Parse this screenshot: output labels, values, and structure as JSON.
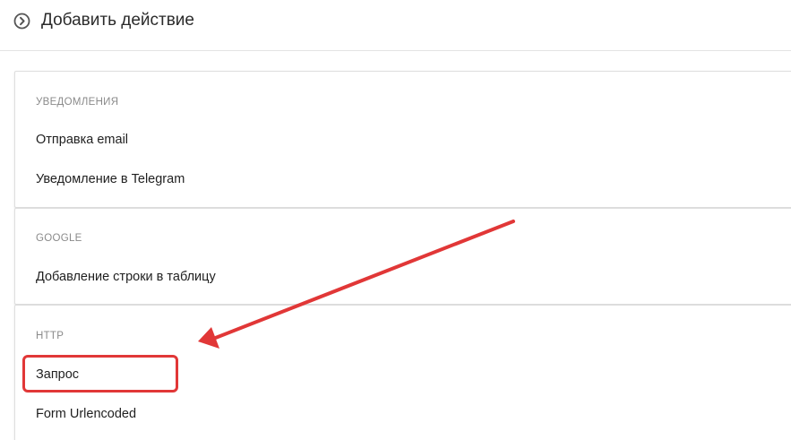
{
  "header": {
    "title": "Добавить действие",
    "icon": "chevron-circle-right-icon"
  },
  "sections": [
    {
      "title": "УВЕДОМЛЕНИЯ",
      "items": [
        "Отправка email",
        "Уведомление в Telegram"
      ]
    },
    {
      "title": "GOOGLE",
      "items": [
        "Добавление строки в таблицу"
      ]
    },
    {
      "title": "HTTP",
      "items": [
        "Запрос",
        "Form Urlencoded"
      ]
    }
  ],
  "annotation": {
    "highlighted_item": "Запрос",
    "color": "#e13737"
  }
}
